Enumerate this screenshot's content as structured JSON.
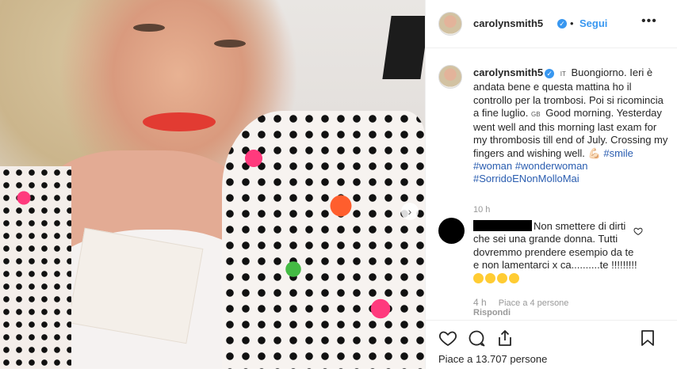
{
  "post": {
    "username": "carolynsmith5",
    "follow_label": "Segui",
    "dot": "•",
    "more": "•••"
  },
  "caption": {
    "username": "carolynsmith5",
    "flag_it": "IT",
    "text_it": "Buongiorno. Ieri è andata bene e questa mattina ho il controllo per la trombosi. Poi si ricomincia a fine luglio.",
    "flag_gb": "GB",
    "text_en": "Good morning. Yesterday went well and this morning last exam for my thrombosis till end of July. Crossing my fingers and wishing well.",
    "emoji": "💪🏻",
    "hashtags": [
      "#smile",
      "#woman",
      "#wonderwoman",
      "#SorridoENonMolloMai"
    ],
    "time": "10 h"
  },
  "comment": {
    "text": "Non smettere di dirti che sei una grande donna. Tutti dovremmo prendere esempio da te e non lamentarci x ca..........te !!!!!!!!!",
    "time": "4 h",
    "likes": "Piace a 4 persone",
    "reply": "Rispondi"
  },
  "footer": {
    "likes": "Piace a 13.707 persone"
  },
  "icons": [
    "verified-badge-icon",
    "next-arrow-icon",
    "heart-icon",
    "comment-icon",
    "share-icon",
    "bookmark-icon",
    "more-options-icon"
  ],
  "colors": {
    "link": "#3897f0",
    "hashtag": "#2a5db0",
    "muted": "#999999",
    "text": "#262626"
  }
}
